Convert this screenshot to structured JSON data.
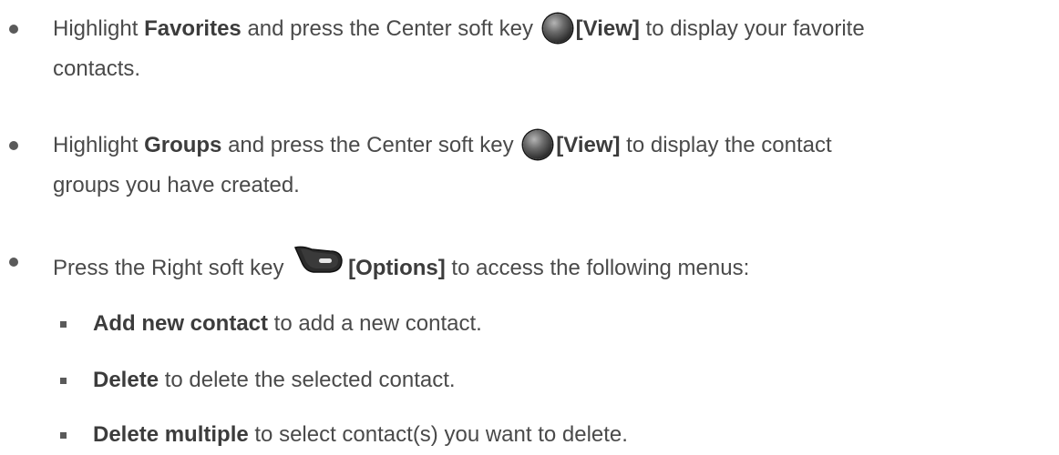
{
  "items": [
    {
      "level": 1,
      "pre": "Highlight ",
      "bold": "Favorites",
      "mid": " and press the Center soft key ",
      "key_icon": "center-soft-key-icon",
      "key_label": "[View]",
      "post_line1": " to display your favorite",
      "line2": "contacts."
    },
    {
      "level": 1,
      "pre": "Highlight ",
      "bold": "Groups",
      "mid": " and press the Center soft key ",
      "key_icon": "center-soft-key-icon",
      "key_label": "[View]",
      "post_line1": " to display the contact",
      "line2": "groups you have created."
    },
    {
      "level": 1,
      "pre": "Press the Right soft key ",
      "key_icon": "right-soft-key-icon",
      "key_label": "[Options]",
      "post": " to access the following menus:"
    }
  ],
  "subitems": [
    {
      "bold": "Add new contact",
      "text": " to add a new contact."
    },
    {
      "bold": "Delete",
      "text": " to delete the selected contact."
    },
    {
      "bold": "Delete multiple",
      "text": " to select contact(s) you want to delete."
    }
  ]
}
